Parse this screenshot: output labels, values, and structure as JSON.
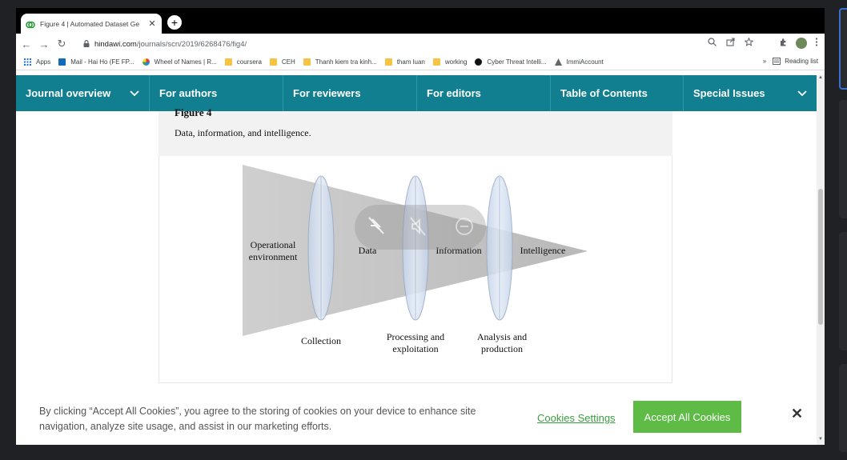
{
  "browser": {
    "tab": {
      "title": "Figure 4 | Automated Dataset Ge",
      "close": "✕"
    },
    "new_tab": "+",
    "url": {
      "host": "hindawi.com",
      "path": "/journals/scn/2019/6268476/fig4/"
    },
    "nav": {
      "back": "←",
      "forward": "→",
      "reload": "↻"
    },
    "bookmarks": [
      {
        "label": "Apps",
        "icon": "apps-grid-icon"
      },
      {
        "label": "Mail - Hai Ho (FE FP...",
        "icon": "outlook-icon"
      },
      {
        "label": "Wheel of Names | R...",
        "icon": "wheel-icon"
      },
      {
        "label": "coursera",
        "icon": "folder-icon"
      },
      {
        "label": "CEH",
        "icon": "folder-icon"
      },
      {
        "label": "Thanh kiem tra kinh...",
        "icon": "folder-icon"
      },
      {
        "label": "tham luan",
        "icon": "folder-icon"
      },
      {
        "label": "working",
        "icon": "folder-icon"
      },
      {
        "label": "Cyber Threat Intelli...",
        "icon": "github-icon"
      },
      {
        "label": "ImmiAccount",
        "icon": "immi-icon"
      }
    ],
    "bookmarks_more": "»",
    "reading_list": "Reading list"
  },
  "journal_nav": [
    {
      "label": "Journal overview",
      "chevron": true
    },
    {
      "label": "For authors",
      "chevron": false
    },
    {
      "label": "For reviewers",
      "chevron": false
    },
    {
      "label": "For editors",
      "chevron": false
    },
    {
      "label": "Table of Contents",
      "chevron": false
    },
    {
      "label": "Special Issues",
      "chevron": true
    }
  ],
  "figure": {
    "label": "Figure 4",
    "caption": "Data, information, and intelligence.",
    "diagram": {
      "operational": "Operational environment",
      "data": "Data",
      "information": "Information",
      "intelligence": "Intelligence",
      "collection": "Collection",
      "processing": "Processing and exploitation",
      "analysis": "Analysis and production"
    }
  },
  "cookie": {
    "text": "By clicking “Accept All Cookies”, you agree to the storing of cookies on your device to enhance site navigation, analyze site usage, and assist in our marketing efforts.",
    "settings": "Cookies Settings",
    "accept": "Accept All Cookies",
    "close": "✕"
  },
  "colors": {
    "nav_bg": "#117f8f",
    "accept_bg": "#5dbb46",
    "link": "#3a9e3f"
  }
}
